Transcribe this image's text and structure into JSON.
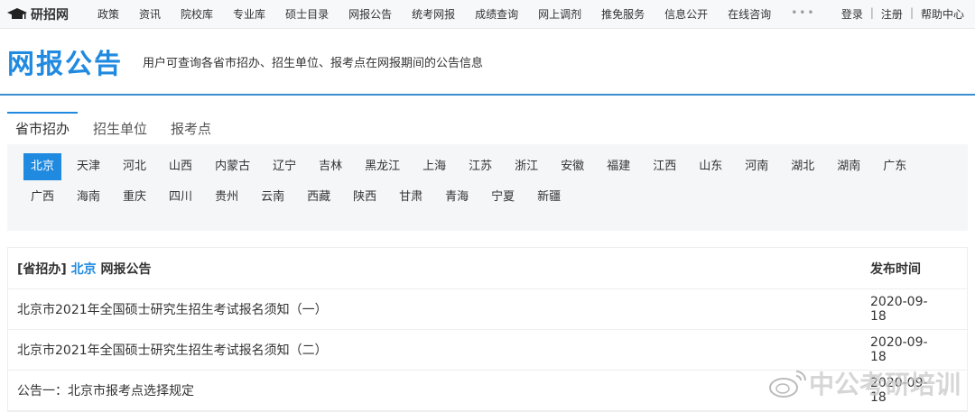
{
  "topbar": {
    "logo": "研招网",
    "nav": [
      "政策",
      "资讯",
      "院校库",
      "专业库",
      "硕士目录",
      "网报公告",
      "统考网报",
      "成绩查询",
      "网上调剂",
      "推免服务",
      "信息公开",
      "在线咨询"
    ],
    "more": "•••",
    "login": "登录",
    "register": "注册",
    "help": "帮助中心",
    "sep": "|"
  },
  "header": {
    "title": "网报公告",
    "subtitle": "用户可查询各省市招办、招生单位、报考点在网报期间的公告信息"
  },
  "tabs": [
    "省市招办",
    "招生单位",
    "报考点"
  ],
  "regions": [
    "北京",
    "天津",
    "河北",
    "山西",
    "内蒙古",
    "辽宁",
    "吉林",
    "黑龙江",
    "上海",
    "江苏",
    "浙江",
    "安徽",
    "福建",
    "江西",
    "山东",
    "河南",
    "湖北",
    "湖南",
    "广东",
    "广西",
    "海南",
    "重庆",
    "四川",
    "贵州",
    "云南",
    "西藏",
    "陕西",
    "甘肃",
    "青海",
    "宁夏",
    "新疆"
  ],
  "table": {
    "prefix": "[省招办]",
    "region": "北京",
    "suffix": "网报公告",
    "date_header": "发布时间",
    "rows": [
      {
        "title": "北京市2021年全国硕士研究生招生考试报名须知（一）",
        "date": "2020-09-18"
      },
      {
        "title": "北京市2021年全国硕士研究生招生考试报名须知（二）",
        "date": "2020-09-18"
      },
      {
        "title": "公告一：北京市报考点选择规定",
        "date": "2020-09-18"
      }
    ]
  },
  "watermark": "中公考研培训"
}
